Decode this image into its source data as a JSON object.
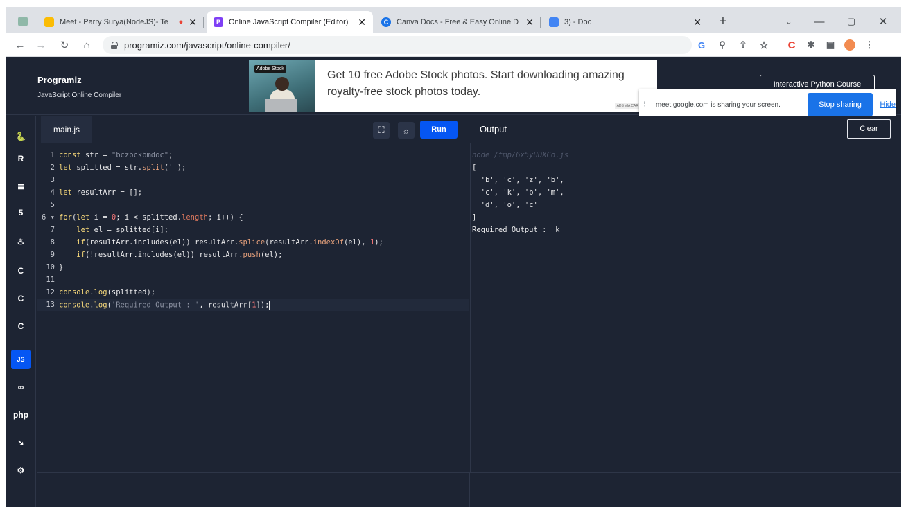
{
  "browser": {
    "tabs": [
      {
        "title": "Meet - Parry Surya(NodeJS)- Te",
        "color": "#fbbc04",
        "active": false
      },
      {
        "title": "Online JavaScript Compiler (Editor)",
        "color": "#7f3ff5",
        "active": true
      },
      {
        "title": "Canva Docs - Free & Easy Online D",
        "color": "#1a73e8",
        "active": false
      },
      {
        "title": "3) - Doc",
        "color": "#4285f4",
        "active": false
      }
    ],
    "url": "programiz.com/javascript/online-compiler/"
  },
  "header": {
    "logo": "Programiz",
    "subtitle": "JavaScript Online Compiler",
    "ad": {
      "badge": "Adobe Stock",
      "text": "Get 10 free Adobe Stock photos. Start downloading amazing royalty-free stock photos today.",
      "choice": "ADS VIA CAR"
    },
    "course_button": "Interactive Python Course",
    "share": {
      "message": "meet.google.com is sharing your screen.",
      "stop": "Stop sharing",
      "hide": "Hide"
    }
  },
  "sidebar": {
    "languages": [
      {
        "name": "python-icon",
        "glyph": "🐍"
      },
      {
        "name": "r-icon",
        "glyph": "R"
      },
      {
        "name": "sql-icon",
        "glyph": "≣"
      },
      {
        "name": "html-icon",
        "glyph": "5"
      },
      {
        "name": "java-icon",
        "glyph": "♨"
      },
      {
        "name": "c-icon",
        "glyph": "C"
      },
      {
        "name": "cpp-icon",
        "glyph": "C"
      },
      {
        "name": "csharp-icon",
        "glyph": "C"
      },
      {
        "name": "javascript-icon",
        "glyph": "JS"
      },
      {
        "name": "go-icon",
        "glyph": "∞"
      },
      {
        "name": "php-icon",
        "glyph": "php"
      },
      {
        "name": "swift-icon",
        "glyph": "➘"
      },
      {
        "name": "rust-icon",
        "glyph": "⚙"
      }
    ]
  },
  "editor": {
    "file_name": "main.js",
    "run_label": "Run",
    "lines": [
      {
        "n": "1",
        "html": "<span class='kw'>const</span> str = <span class='str'>\"bczbckbmdoc\"</span>;"
      },
      {
        "n": "2",
        "html": "<span class='kw'>let</span> splitted = str.<span class='fn'>split</span>(<span class='str'>''</span>);"
      },
      {
        "n": "3",
        "html": ""
      },
      {
        "n": "4",
        "html": "<span class='kw'>let</span> resultArr = [];"
      },
      {
        "n": "5",
        "html": ""
      },
      {
        "n": "6 ▾",
        "html": "<span class='kw'>for</span>(<span class='kw'>let</span> i = <span class='num'>0</span>; i &lt; splitted.<span class='prop'>length</span>; i++) {"
      },
      {
        "n": "7",
        "html": "    <span class='kw'>let</span> el = splitted[i];"
      },
      {
        "n": "8",
        "html": "    <span class='kw'>if</span>(resultArr.includes(el)) resultArr.<span class='fn'>splice</span>(resultArr.<span class='fn'>indexOf</span>(el), <span class='num'>1</span>);"
      },
      {
        "n": "9",
        "html": "    <span class='kw'>if</span>(!resultArr.includes(el)) resultArr.<span class='fn'>push</span>(el);"
      },
      {
        "n": "10",
        "html": "}"
      },
      {
        "n": "11",
        "html": ""
      },
      {
        "n": "12",
        "html": "<span class='kw'>console</span>.<span class='kw'>log</span>(splitted);"
      },
      {
        "n": "13",
        "html": "<span class='kw'>console</span>.<span class='kw'>log</span>(<span class='str'>'Required Output : '</span>, resultArr[<span class='num'>1</span>]);<span class='caret'></span>"
      }
    ]
  },
  "output": {
    "title": "Output",
    "clear_label": "Clear",
    "lines": [
      {
        "text": "node /tmp/6x5yUDXCo.js",
        "dim": true
      },
      {
        "text": "[",
        "dim": false
      },
      {
        "text": "  'b', 'c', 'z', 'b',",
        "dim": false
      },
      {
        "text": "  'c', 'k', 'b', 'm',",
        "dim": false
      },
      {
        "text": "  'd', 'o', 'c'",
        "dim": false
      },
      {
        "text": "]",
        "dim": false
      },
      {
        "text": "Required Output :  k",
        "dim": false
      }
    ]
  }
}
